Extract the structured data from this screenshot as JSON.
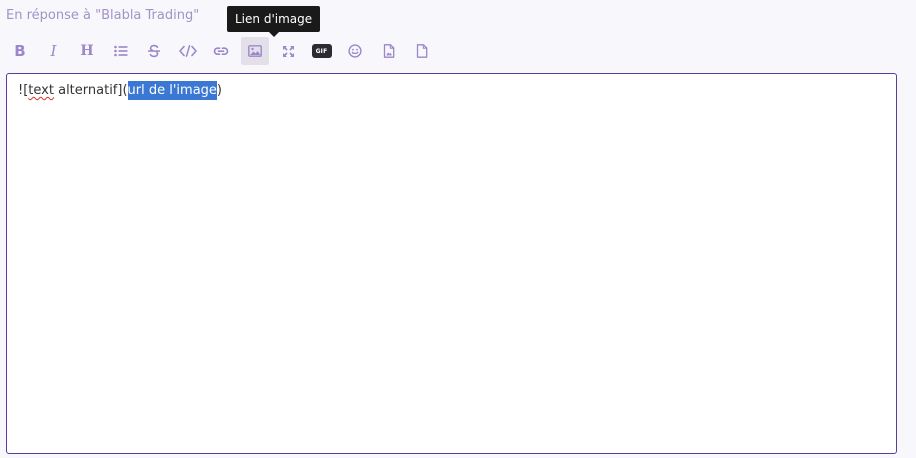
{
  "reply": {
    "label": "En réponse à \"Blabla Trading\""
  },
  "tooltip": {
    "text": "Lien d'image"
  },
  "toolbar": {
    "icon_color": "#9b87c9",
    "active_bg": "#e3e0ea",
    "buttons": [
      {
        "icon": "bold-icon",
        "glyph": "B"
      },
      {
        "icon": "italic-icon",
        "glyph": "I"
      },
      {
        "icon": "heading-icon",
        "glyph": "H"
      },
      {
        "icon": "bulleted-list-icon"
      },
      {
        "icon": "strikethrough-icon",
        "glyph": "S"
      },
      {
        "icon": "code-icon"
      },
      {
        "icon": "link-icon"
      },
      {
        "icon": "image-icon",
        "active": true
      },
      {
        "icon": "expand-icon"
      },
      {
        "icon": "gif-icon",
        "glyph": "GIF"
      },
      {
        "icon": "emoji-icon"
      },
      {
        "icon": "image-file-icon"
      },
      {
        "icon": "file-icon"
      }
    ]
  },
  "editor": {
    "border_color": "#5b3d9e",
    "text_before": "![",
    "text_misspelled": "text",
    "text_middle": " alternatif](",
    "text_selected": "url de l'image",
    "text_after": ")",
    "selection_color": "#3a78d4"
  }
}
